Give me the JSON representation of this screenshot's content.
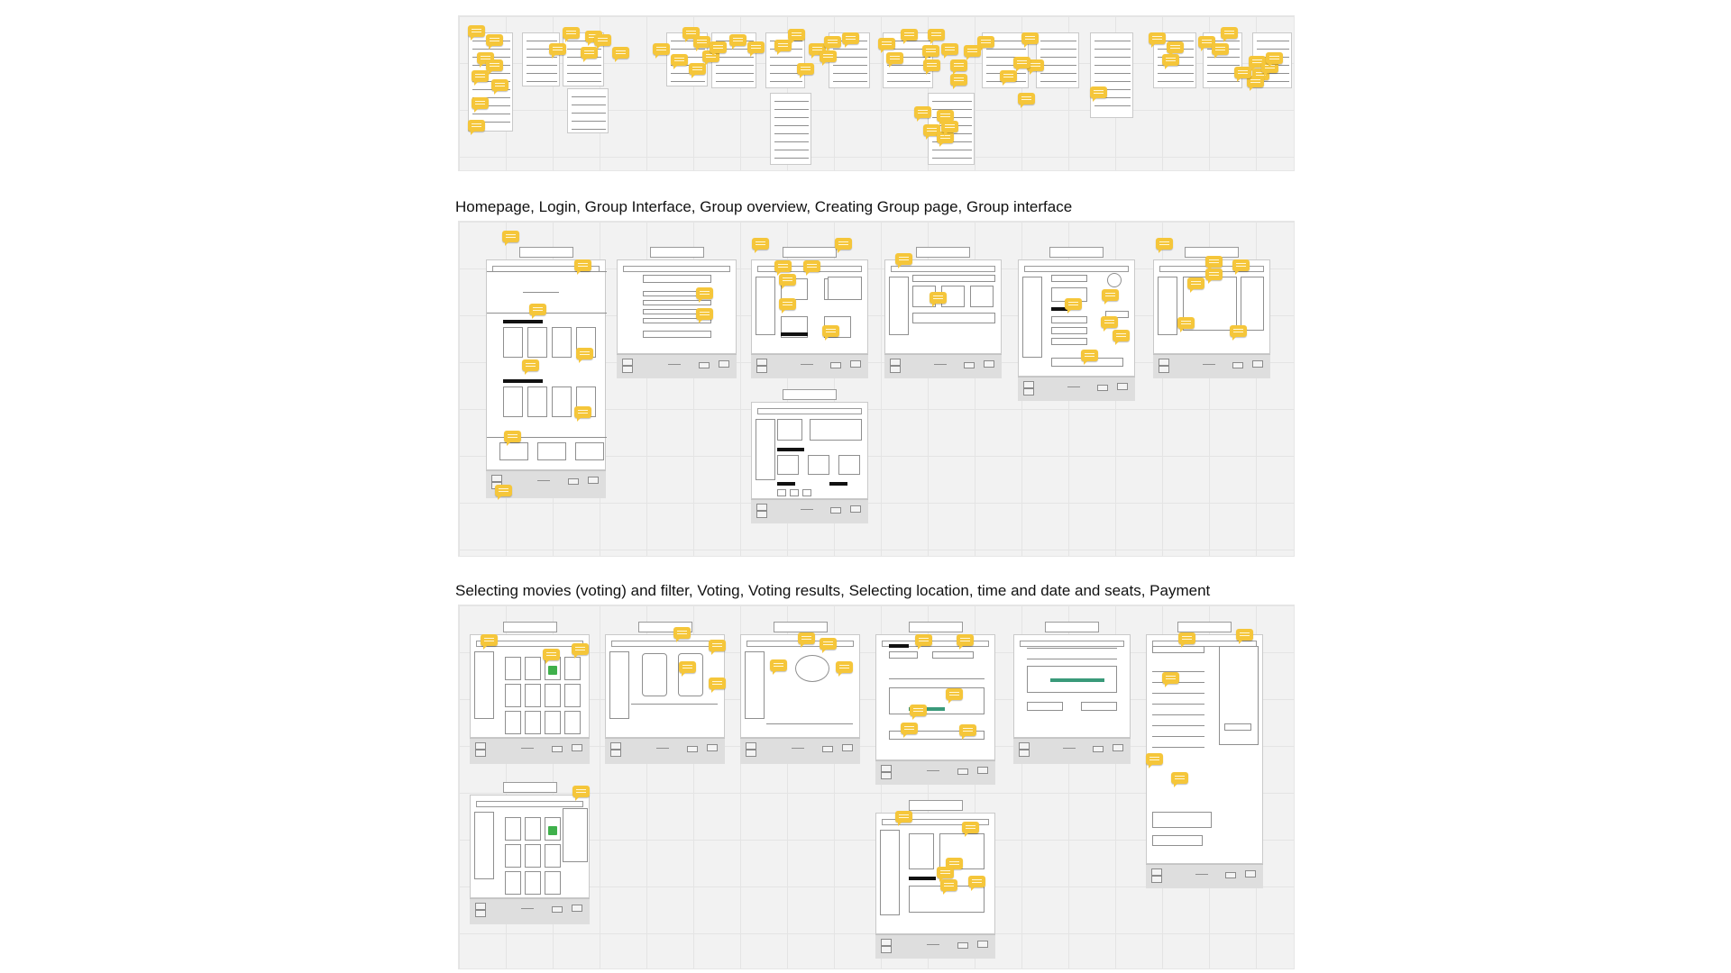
{
  "sections": [
    {
      "title": ""
    },
    {
      "title": "Homepage, Login, Group Interface, Group overview, Creating Group page, Group interface"
    },
    {
      "title": "Selecting movies (voting) and filter, Voting, Voting results, Selecting location, time and date and seats, Payment"
    }
  ],
  "colors": {
    "board": "#f2f2f2",
    "note": "#f5c63a",
    "check": "#3fb04b",
    "seats": "#3a9a7a"
  },
  "icons": {
    "note": "comment-sticky-note-icon",
    "vote": "checkmark-icon"
  }
}
